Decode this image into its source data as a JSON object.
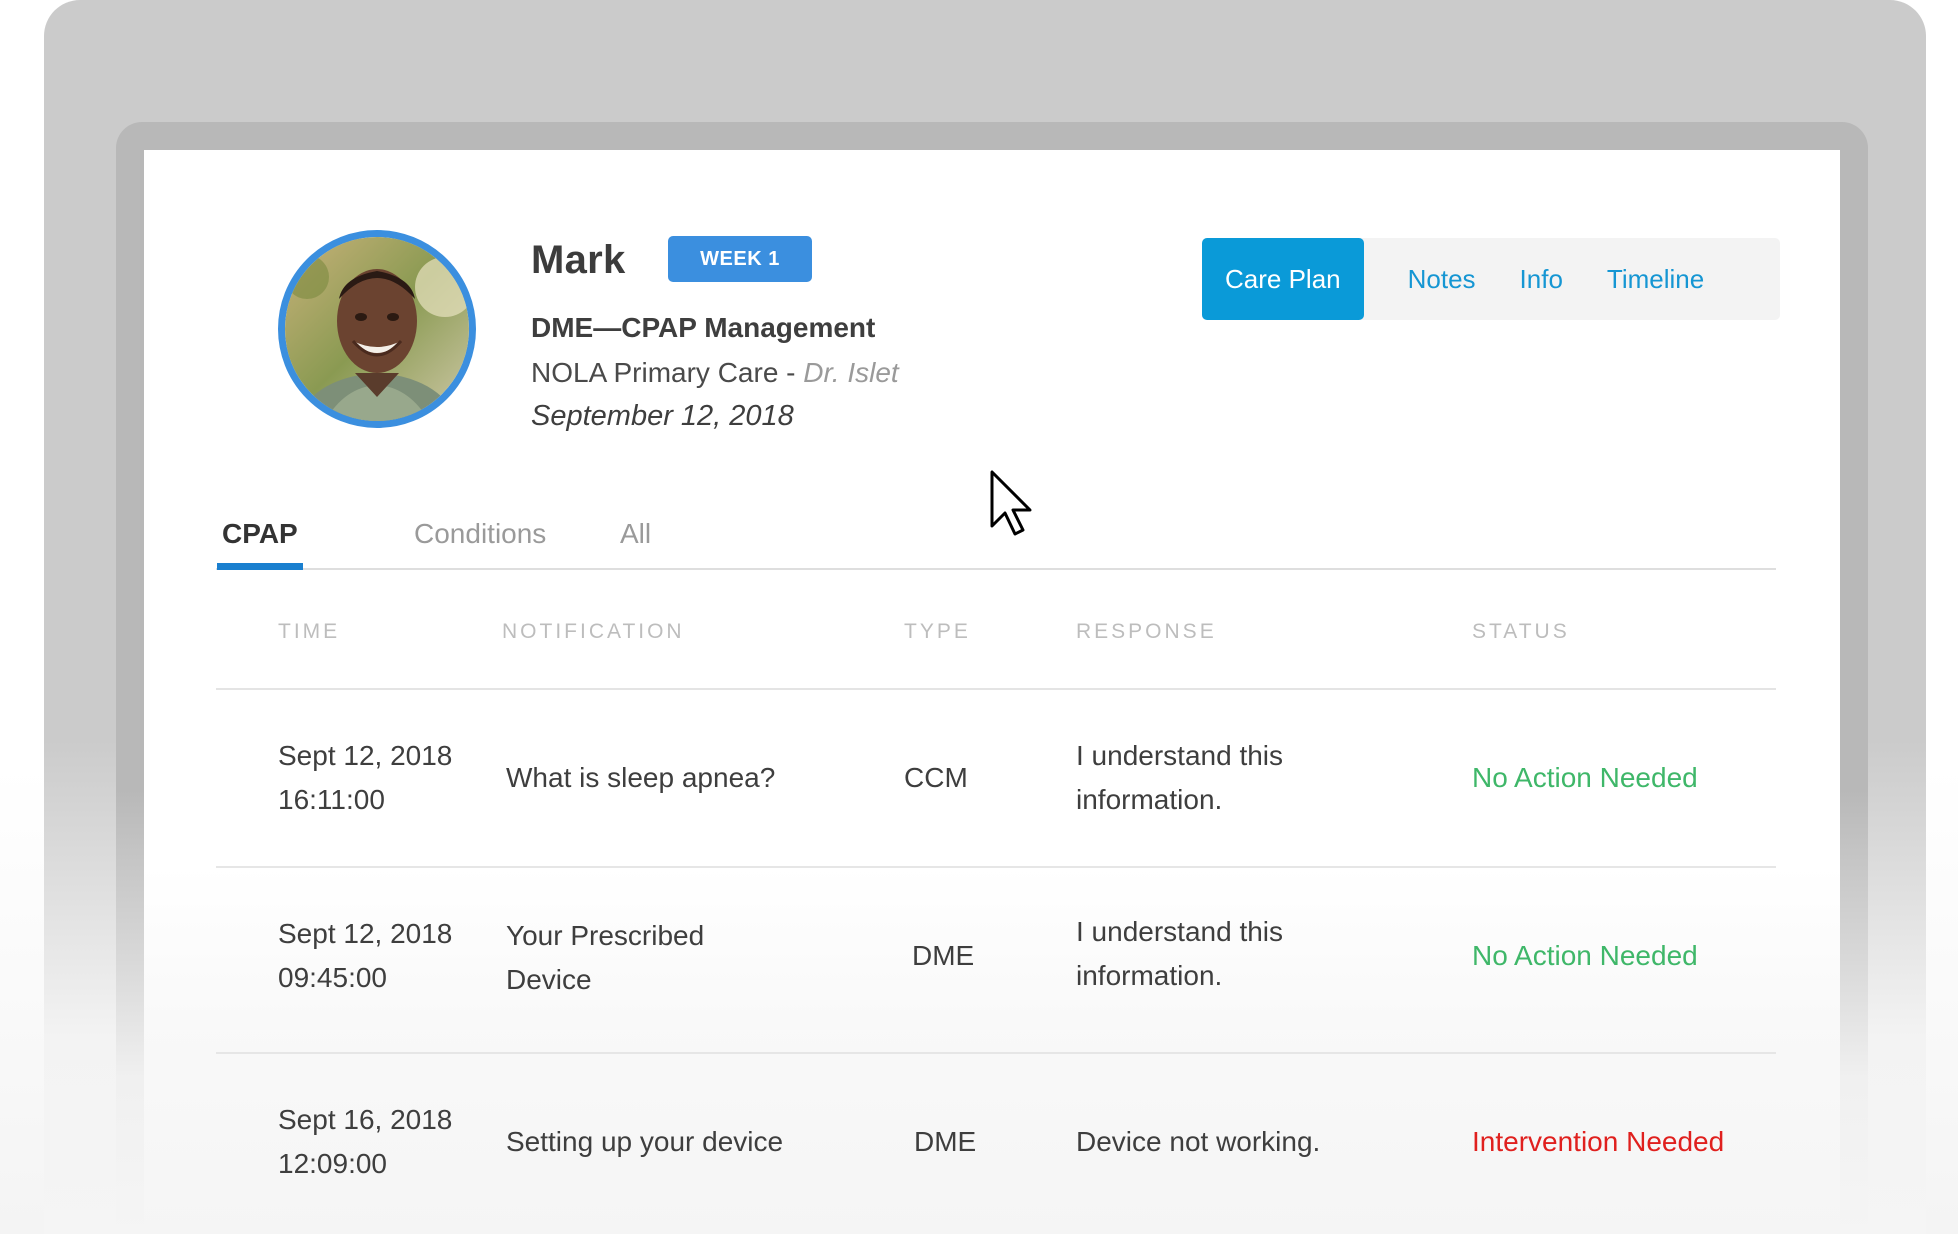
{
  "patient": {
    "name": "Mark",
    "badge": "WEEK 1",
    "program": "DME—CPAP Management",
    "clinic": "NOLA Primary Care",
    "separator": " - ",
    "doctor": "Dr. Islet",
    "date": "September 12, 2018"
  },
  "view_tabs": [
    {
      "label": "Care Plan",
      "active": true
    },
    {
      "label": "Notes",
      "active": false
    },
    {
      "label": "Info",
      "active": false
    },
    {
      "label": "Timeline",
      "active": false
    }
  ],
  "sub_tabs": [
    {
      "label": "CPAP",
      "active": true
    },
    {
      "label": "Conditions",
      "active": false
    },
    {
      "label": "All",
      "active": false
    }
  ],
  "table": {
    "headers": {
      "time": "TIME",
      "notification": "NOTIFICATION",
      "type": "TYPE",
      "response": "RESPONSE",
      "status": "STATUS"
    },
    "rows": [
      {
        "date": "Sept 12, 2018",
        "time": "16:11:00",
        "notification": [
          "What is sleep apnea?"
        ],
        "type": "CCM",
        "response": [
          "I understand this",
          "information."
        ],
        "status": "No Action Needed",
        "status_color": "#3fb769"
      },
      {
        "date": "Sept 12, 2018",
        "time": "09:45:00",
        "notification": [
          "Your Prescribed",
          "Device"
        ],
        "type": "DME",
        "response": [
          "I understand this",
          "information."
        ],
        "status": "No Action Needed",
        "status_color": "#3fb769"
      },
      {
        "date": "Sept 16, 2018",
        "time": "12:09:00",
        "notification": [
          "Setting up your device"
        ],
        "type": "DME",
        "response": [
          "Device not working."
        ],
        "status": "Intervention Needed",
        "status_color": "#e0201e"
      }
    ]
  },
  "colors": {
    "accent": "#3b8fdf",
    "tab_active": "#0a9ad8",
    "link": "#1596d3",
    "ok": "#3fb769",
    "alert": "#e0201e"
  },
  "icons": {
    "cursor": "mouse-pointer-icon"
  }
}
